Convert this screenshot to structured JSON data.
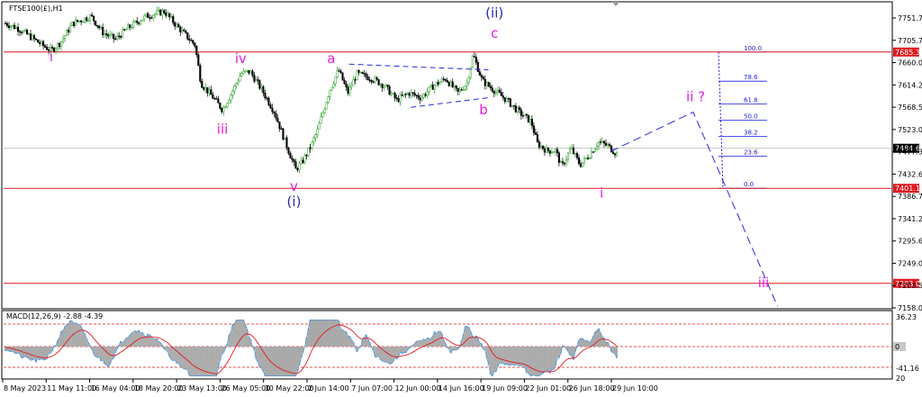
{
  "chart_data": [
    {
      "type": "candlestick",
      "symbol_label": "FTSE100(£),H1",
      "ylim": [
        7150,
        7790
      ],
      "y_ticks": [
        "7751.7",
        "7705.7",
        "7660.0",
        "7614.2",
        "7568.5",
        "7523.0",
        "7477.3",
        "7432.6",
        "7386.7",
        "7341.2",
        "7295.6",
        "7249.0",
        "7203.5",
        "7158.0"
      ],
      "x_ticks": [
        "8 May 2023",
        "11 May 11:00",
        "16 May 04:00",
        "18 May 20:00",
        "23 May 13:00",
        "26 May 05:00",
        "30 May 22:00",
        "2 Jun 14:00",
        "7 Jun 07:00",
        "12 Jun 00:00",
        "14 Jun 16:00",
        "19 Jun 09:00",
        "22 Jun 01:00",
        "26 Jun 18:00",
        "29 Jun 10:00"
      ],
      "price_path": [
        [
          0,
          7745
        ],
        [
          0.02,
          7735
        ],
        [
          0.04,
          7718
        ],
        [
          0.06,
          7700
        ],
        [
          0.075,
          7688
        ],
        [
          0.09,
          7705
        ],
        [
          0.11,
          7745
        ],
        [
          0.14,
          7760
        ],
        [
          0.16,
          7725
        ],
        [
          0.18,
          7712
        ],
        [
          0.2,
          7735
        ],
        [
          0.23,
          7760
        ],
        [
          0.26,
          7770
        ],
        [
          0.28,
          7740
        ],
        [
          0.31,
          7700
        ],
        [
          0.32,
          7620
        ],
        [
          0.34,
          7590
        ],
        [
          0.355,
          7565
        ],
        [
          0.37,
          7600
        ],
        [
          0.385,
          7640
        ],
        [
          0.4,
          7645
        ],
        [
          0.42,
          7605
        ],
        [
          0.44,
          7560
        ],
        [
          0.46,
          7490
        ],
        [
          0.475,
          7440
        ],
        [
          0.485,
          7455
        ],
        [
          0.5,
          7490
        ],
        [
          0.51,
          7520
        ],
        [
          0.53,
          7605
        ],
        [
          0.545,
          7648
        ],
        [
          0.56,
          7600
        ],
        [
          0.575,
          7640
        ],
        [
          0.6,
          7630
        ],
        [
          0.62,
          7615
        ],
        [
          0.64,
          7585
        ],
        [
          0.66,
          7600
        ],
        [
          0.68,
          7590
        ],
        [
          0.7,
          7615
        ],
        [
          0.72,
          7630
        ],
        [
          0.74,
          7600
        ],
        [
          0.755,
          7620
        ],
        [
          0.765,
          7680
        ],
        [
          0.78,
          7625
        ],
        [
          0.8,
          7605
        ],
        [
          0.82,
          7585
        ],
        [
          0.84,
          7560
        ],
        [
          0.86,
          7540
        ],
        [
          0.87,
          7495
        ],
        [
          0.885,
          7480
        ],
        [
          0.9,
          7480
        ],
        [
          0.91,
          7445
        ],
        [
          0.925,
          7485
        ],
        [
          0.94,
          7450
        ],
        [
          0.955,
          7470
        ],
        [
          0.97,
          7498
        ],
        [
          0.985,
          7490
        ],
        [
          1.0,
          7473
        ]
      ],
      "current_price": "7484.6",
      "horizontal_levels": [
        {
          "label": "7685.3",
          "value": 7685.3,
          "color": "#e0191f"
        },
        {
          "label": "7401.1",
          "value": 7401.1,
          "color": "#e0191f"
        },
        {
          "label": "7203.0",
          "value": 7203.0,
          "color": "#e0191f"
        }
      ],
      "fibonacci": [
        {
          "label": "100.0",
          "value": 7685.3
        },
        {
          "label": "78.6",
          "value": 7624.5
        },
        {
          "label": "61.8",
          "value": 7576.7
        },
        {
          "label": "50.0",
          "value": 7543.2
        },
        {
          "label": "38.2",
          "value": 7509.6
        },
        {
          "label": "23.6",
          "value": 7468.1
        },
        {
          "label": "0.0",
          "value": 7401.1
        }
      ],
      "wave_labels": [
        {
          "text": "i",
          "color": "#e01ee0",
          "at": [
            0.075,
            7666
          ]
        },
        {
          "text": "iii",
          "color": "#e01ee0",
          "at": [
            0.355,
            7515
          ]
        },
        {
          "text": "iv",
          "color": "#e01ee0",
          "at": [
            0.385,
            7662
          ]
        },
        {
          "text": "v",
          "color": "#e01ee0",
          "at": [
            0.472,
            7396
          ]
        },
        {
          "text": "(i)",
          "color": "#2a2aa8",
          "at": [
            0.472,
            7364
          ]
        },
        {
          "text": "a",
          "color": "#e01ee0",
          "at": [
            0.533,
            7662
          ]
        },
        {
          "text": "b",
          "color": "#e01ee0",
          "at": [
            0.782,
            7555
          ]
        },
        {
          "text": "c",
          "color": "#e01ee0",
          "at": [
            0.8,
            7715
          ]
        },
        {
          "text": "(ii)",
          "color": "#2a2aa8",
          "at": [
            0.8,
            7757
          ]
        },
        {
          "text": "i",
          "color": "#e01ee0",
          "at": [
            0.975,
            7382
          ]
        },
        {
          "text": "ii ?",
          "color": "#e01ee0",
          "at": [
            1.129,
            7583
          ]
        },
        {
          "text": "iii",
          "color": "#e01ee0",
          "at": [
            1.24,
            7195
          ]
        }
      ],
      "projection_path": [
        [
          0.99,
          7478
        ],
        [
          1.125,
          7560
        ],
        [
          1.263,
          7155
        ]
      ],
      "triangle_lines": [
        [
          [
            0.562,
            7660
          ],
          [
            0.79,
            7648
          ]
        ],
        [
          [
            0.663,
            7570
          ],
          [
            0.79,
            7590
          ]
        ]
      ]
    },
    {
      "type": "macd",
      "title": "MACD(12,26,9) -2.88 -4.39",
      "y_ticks": [
        "36.23",
        "0",
        "-41.16"
      ],
      "zero_label": "0"
    }
  ]
}
